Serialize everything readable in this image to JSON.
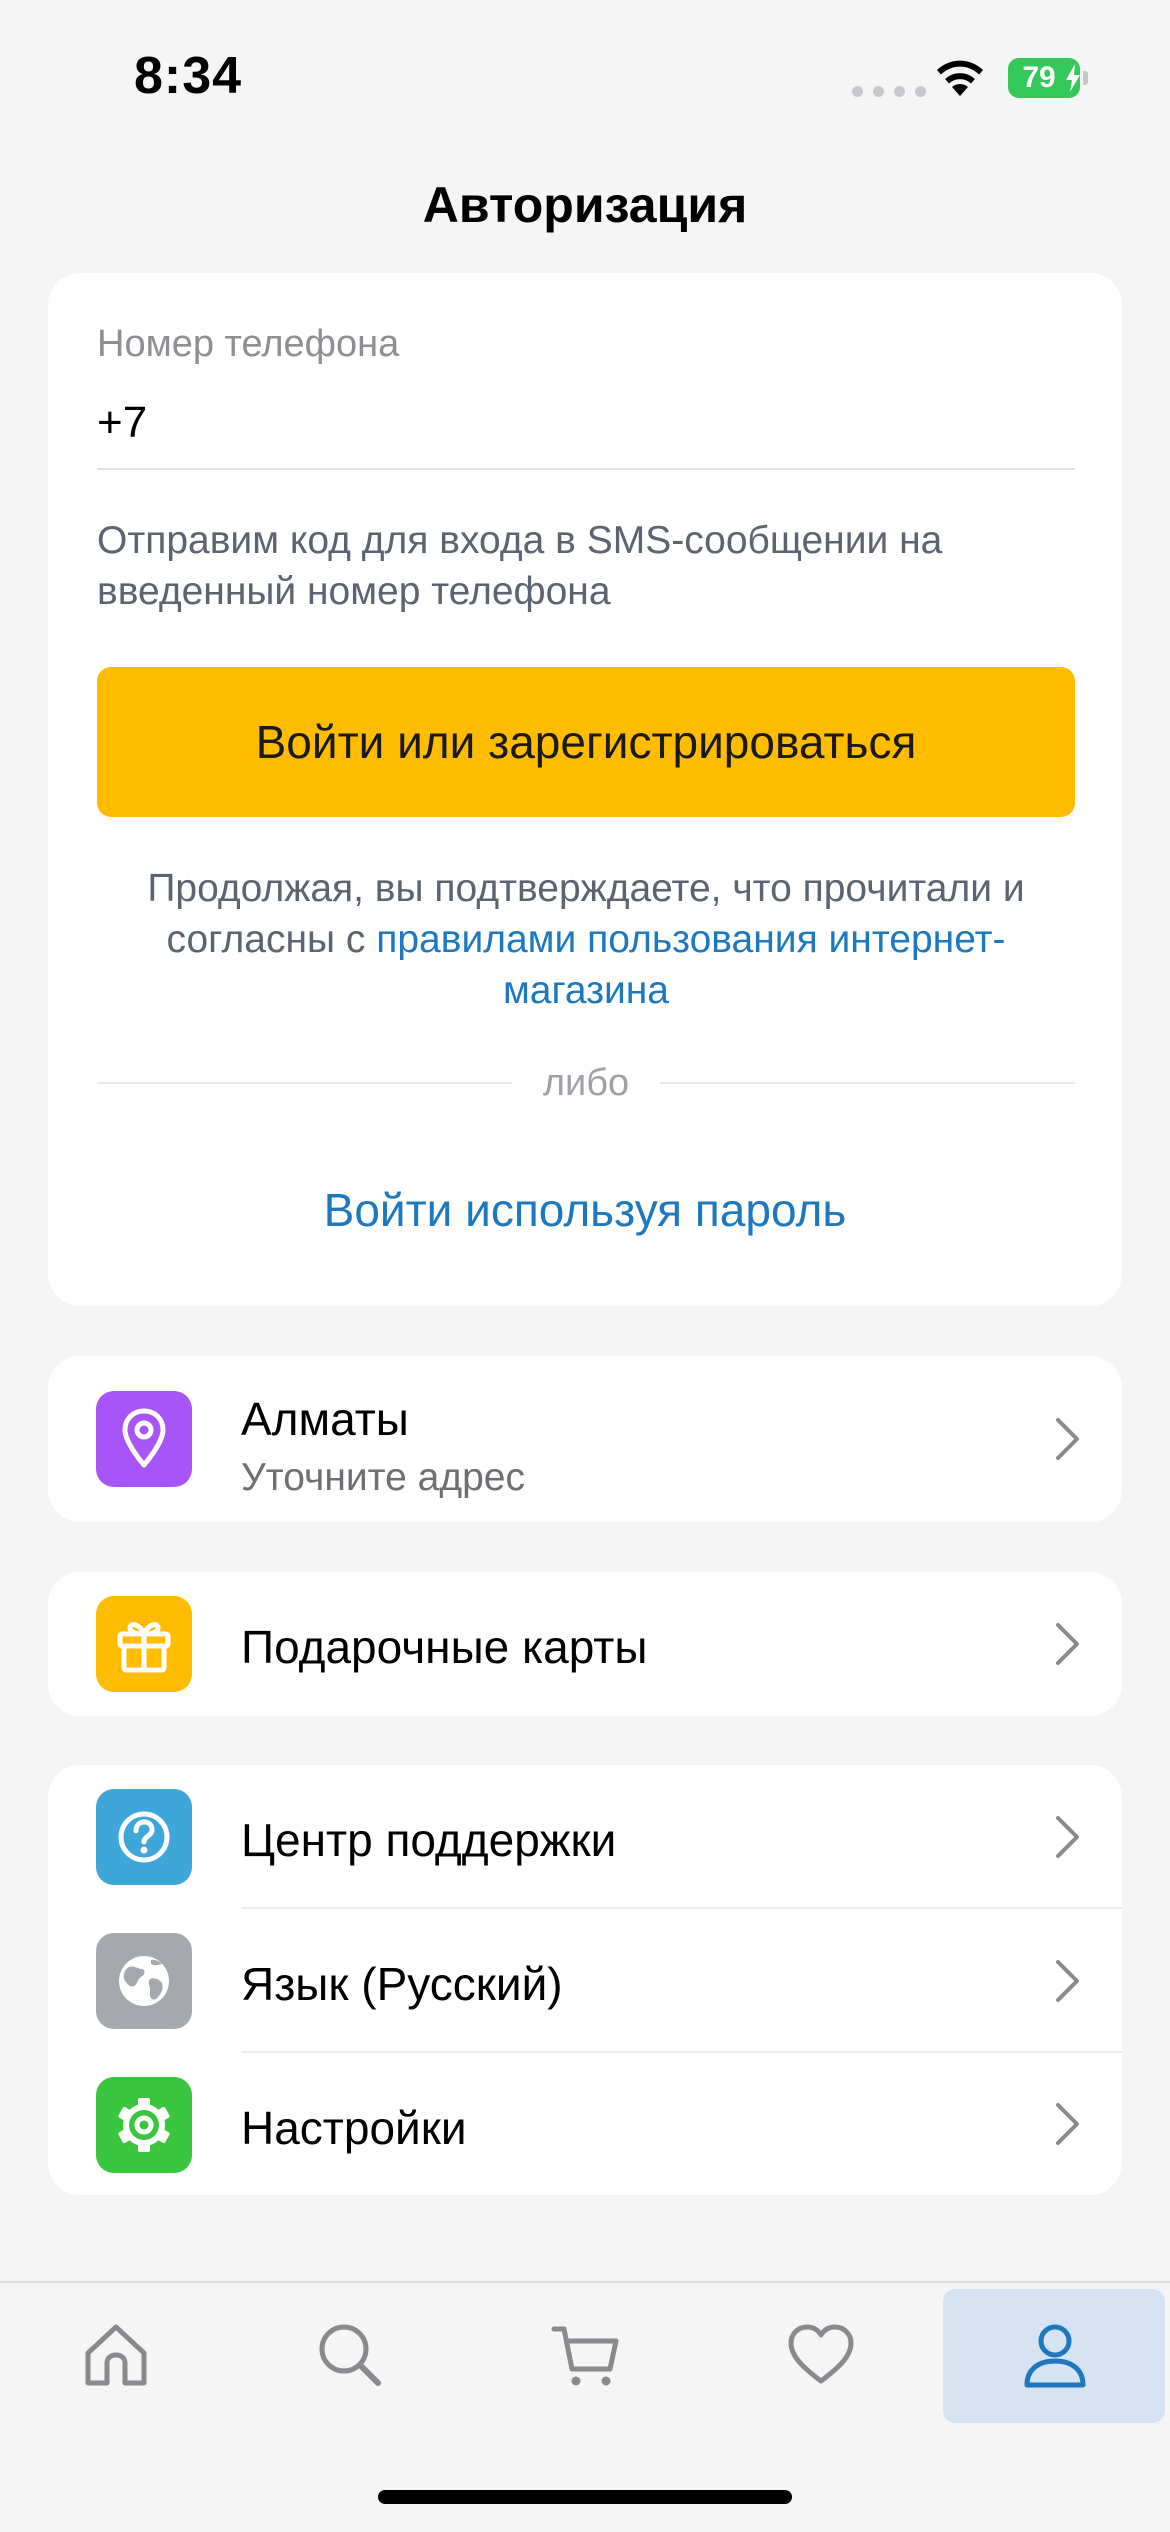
{
  "status_bar": {
    "time": "8:34",
    "battery": "79"
  },
  "header": {
    "title": "Авторизация"
  },
  "auth": {
    "phone_label": "Номер телефона",
    "phone_value": "+7",
    "sms_hint": "Отправим код для входа в SMS-сообщении на введенный номер телефона",
    "submit_label": "Войти или зарегистрироваться",
    "terms_prefix": "Продолжая, вы подтверждаете, что прочитали и согласны с ",
    "terms_link": "правилами пользования интернет-магазина",
    "divider_text": "либо",
    "password_login_label": "Войти используя пароль"
  },
  "location": {
    "city": "Алматы",
    "hint": "Уточните адрес",
    "icon": "location-pin-icon",
    "color": "#a855f7"
  },
  "gift_cards": {
    "label": "Подарочные карты",
    "icon": "gift-icon",
    "color": "#ffbc00"
  },
  "menu": {
    "items": [
      {
        "label": "Центр поддержки",
        "icon": "help-icon",
        "color": "#3ea6d8"
      },
      {
        "label": "Язык (Русский)",
        "icon": "globe-icon",
        "color": "#a5a9ad"
      },
      {
        "label": "Настройки",
        "icon": "gear-icon",
        "color": "#39c53d"
      }
    ]
  },
  "tab_bar": {
    "tabs": [
      {
        "name": "home",
        "icon": "home-icon"
      },
      {
        "name": "search",
        "icon": "search-icon"
      },
      {
        "name": "cart",
        "icon": "cart-icon"
      },
      {
        "name": "favorites",
        "icon": "heart-icon"
      },
      {
        "name": "profile",
        "icon": "user-icon",
        "active": true
      }
    ],
    "active_color": "#1e78be",
    "inactive_color": "#8a8a8e"
  }
}
